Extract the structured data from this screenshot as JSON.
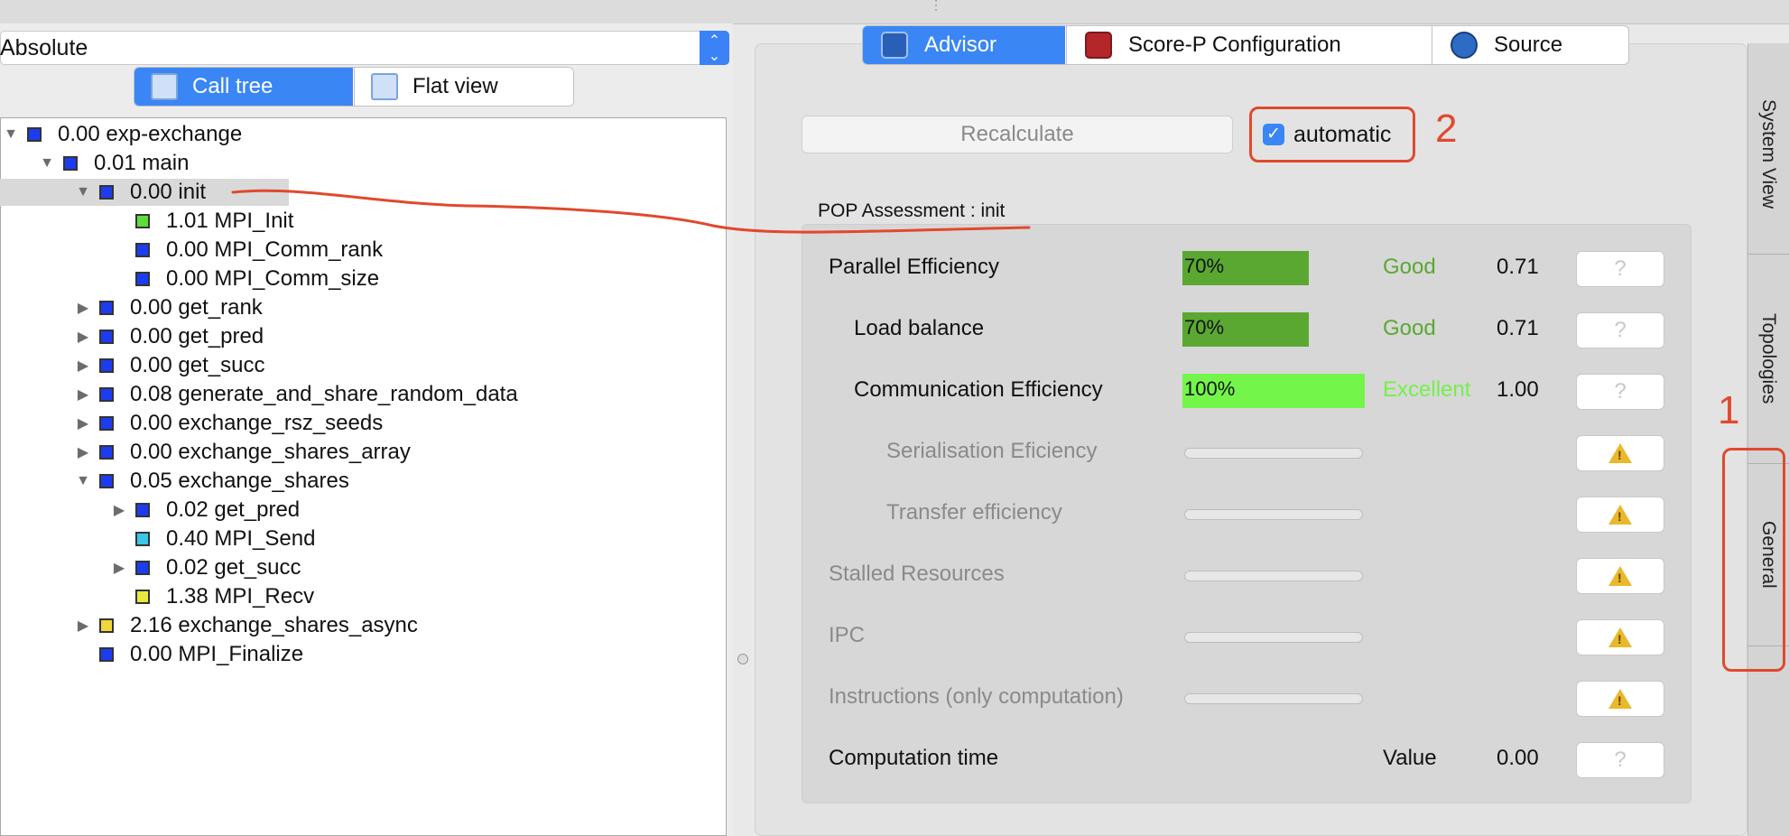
{
  "metric_select": {
    "value": "Absolute"
  },
  "left_tabs": {
    "call_tree": "Call tree",
    "flat_view": "Flat view"
  },
  "tree": [
    {
      "value": "0.00",
      "name": "exp-exchange",
      "indent": 0,
      "toggle": "open",
      "color": "#1d3cf0"
    },
    {
      "value": "0.01",
      "name": "main",
      "indent": 1,
      "toggle": "open",
      "color": "#1d3cf0"
    },
    {
      "value": "0.00",
      "name": "init",
      "indent": 2,
      "toggle": "open",
      "color": "#1d3cf0",
      "selected": true
    },
    {
      "value": "1.01",
      "name": "MPI_Init",
      "indent": 3,
      "toggle": "none",
      "color": "#5ddc3c"
    },
    {
      "value": "0.00",
      "name": "MPI_Comm_rank",
      "indent": 3,
      "toggle": "none",
      "color": "#1d3cf0"
    },
    {
      "value": "0.00",
      "name": "MPI_Comm_size",
      "indent": 3,
      "toggle": "none",
      "color": "#1d3cf0"
    },
    {
      "value": "0.00",
      "name": "get_rank",
      "indent": 2,
      "toggle": "closed",
      "color": "#1d3cf0"
    },
    {
      "value": "0.00",
      "name": "get_pred",
      "indent": 2,
      "toggle": "closed",
      "color": "#1d3cf0"
    },
    {
      "value": "0.00",
      "name": "get_succ",
      "indent": 2,
      "toggle": "closed",
      "color": "#1d3cf0"
    },
    {
      "value": "0.08",
      "name": "generate_and_share_random_data",
      "indent": 2,
      "toggle": "closed",
      "color": "#1d3cf0"
    },
    {
      "value": "0.00",
      "name": "exchange_rsz_seeds",
      "indent": 2,
      "toggle": "closed",
      "color": "#1d3cf0"
    },
    {
      "value": "0.00",
      "name": "exchange_shares_array",
      "indent": 2,
      "toggle": "closed",
      "color": "#1d3cf0"
    },
    {
      "value": "0.05",
      "name": "exchange_shares",
      "indent": 2,
      "toggle": "open",
      "color": "#1d3cf0"
    },
    {
      "value": "0.02",
      "name": "get_pred",
      "indent": 3,
      "toggle": "closed",
      "color": "#1d3cf0"
    },
    {
      "value": "0.40",
      "name": "MPI_Send",
      "indent": 3,
      "toggle": "none",
      "color": "#3cc7e8"
    },
    {
      "value": "0.02",
      "name": "get_succ",
      "indent": 3,
      "toggle": "closed",
      "color": "#1d3cf0"
    },
    {
      "value": "1.38",
      "name": "MPI_Recv",
      "indent": 3,
      "toggle": "none",
      "color": "#e8e83c"
    },
    {
      "value": "2.16",
      "name": "exchange_shares_async",
      "indent": 2,
      "toggle": "closed",
      "color": "#f0d83c"
    },
    {
      "value": "0.00",
      "name": "MPI_Finalize",
      "indent": 2,
      "toggle": "none",
      "color": "#1d3cf0"
    }
  ],
  "right_tabs": {
    "advisor": "Advisor",
    "scorep": "Score-P Configuration",
    "source": "Source"
  },
  "recalculate_label": "Recalculate",
  "automatic_label": "automatic",
  "automatic_checked": true,
  "assessment_title": "POP Assessment : init",
  "metrics": [
    {
      "label": "Parallel Efficiency",
      "active": true,
      "indent": 0,
      "percent": "70%",
      "fraction": 0.7,
      "rating": "Good",
      "value": "0.71",
      "button": "help"
    },
    {
      "label": "Load balance",
      "active": true,
      "indent": 1,
      "percent": "70%",
      "fraction": 0.7,
      "rating": "Good",
      "value": "0.71",
      "button": "help"
    },
    {
      "label": "Communication Efficiency",
      "active": true,
      "indent": 1,
      "percent": "100%",
      "fraction": 1.0,
      "rating": "Excellent",
      "value": "1.00",
      "button": "help"
    },
    {
      "label": "Serialisation Eficiency",
      "active": false,
      "indent": 2,
      "button": "warning"
    },
    {
      "label": "Transfer efficiency",
      "active": false,
      "indent": 2,
      "button": "warning"
    },
    {
      "label": "Stalled Resources",
      "active": false,
      "indent": 0,
      "button": "warning"
    },
    {
      "label": "IPC",
      "active": false,
      "indent": 0,
      "button": "warning"
    },
    {
      "label": "Instructions (only computation)",
      "active": false,
      "indent": 0,
      "button": "warning"
    },
    {
      "label": "Computation time",
      "active": true,
      "indent": 0,
      "rating": "Value",
      "value": "0.00",
      "button": "help"
    }
  ],
  "side_tabs": {
    "system_view": "System View",
    "topologies": "Topologies",
    "general": "General"
  },
  "annotations": {
    "number_1": "1",
    "number_2": "2"
  },
  "colors": {
    "good": "#5aa832",
    "excellent": "#74f04a",
    "good_bar": "#5aa832",
    "excellent_bar": "#74f54a",
    "accent": "#3a86f5",
    "annotation": "#e0492e",
    "inactive": "#8a8a8a"
  }
}
